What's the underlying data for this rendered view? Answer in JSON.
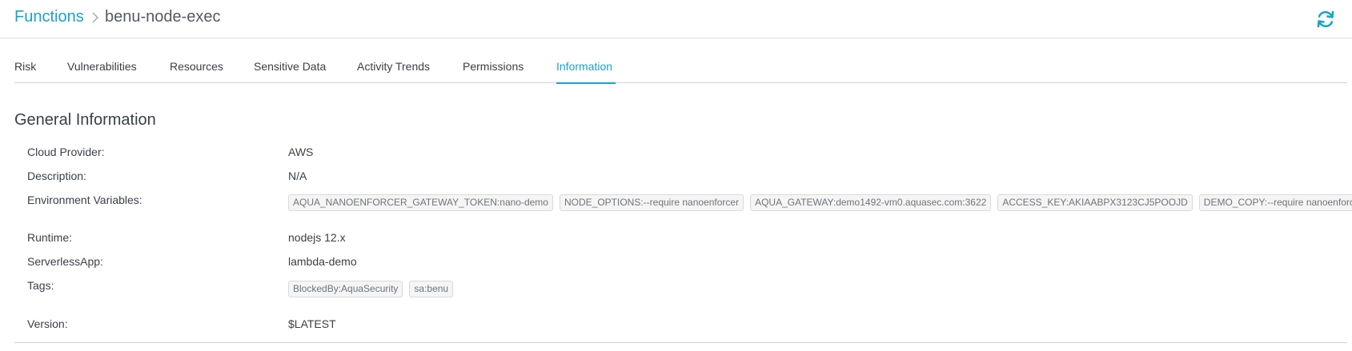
{
  "breadcrumb": {
    "root": "Functions",
    "current": "benu-node-exec"
  },
  "tabs": [
    {
      "label": "Risk",
      "active": false
    },
    {
      "label": "Vulnerabilities",
      "active": false
    },
    {
      "label": "Resources",
      "active": false
    },
    {
      "label": "Sensitive Data",
      "active": false
    },
    {
      "label": "Activity Trends",
      "active": false
    },
    {
      "label": "Permissions",
      "active": false
    },
    {
      "label": "Information",
      "active": true
    }
  ],
  "section": {
    "title": "General Information"
  },
  "fields": {
    "cloud_provider": {
      "label": "Cloud Provider:",
      "value": "AWS"
    },
    "description": {
      "label": "Description:",
      "value": "N/A"
    },
    "env_vars": {
      "label": "Environment Variables:",
      "chips": [
        "AQUA_NANOENFORCER_GATEWAY_TOKEN:nano-demo",
        "NODE_OPTIONS:--require nanoenforcer",
        "AQUA_GATEWAY:demo1492-vm0.aquasec.com:3622",
        "ACCESS_KEY:AKIAABPX3123CJ5POOJD",
        "DEMO_COPY:--require nanoenforcer"
      ]
    },
    "runtime": {
      "label": "Runtime:",
      "value": "nodejs 12.x"
    },
    "serverless_app": {
      "label": "ServerlessApp:",
      "value": "lambda-demo"
    },
    "tags": {
      "label": "Tags:",
      "chips": [
        "BlockedBy:AquaSecurity",
        "sa:benu"
      ]
    },
    "version": {
      "label": "Version:",
      "value": "$LATEST"
    }
  },
  "colors": {
    "accent": "#1aa3c9",
    "text": "#3a3f45",
    "divider": "#c9d3dc"
  },
  "icons": {
    "breadcrumb_separator": "chevron-right-icon",
    "refresh": "refresh-icon"
  }
}
